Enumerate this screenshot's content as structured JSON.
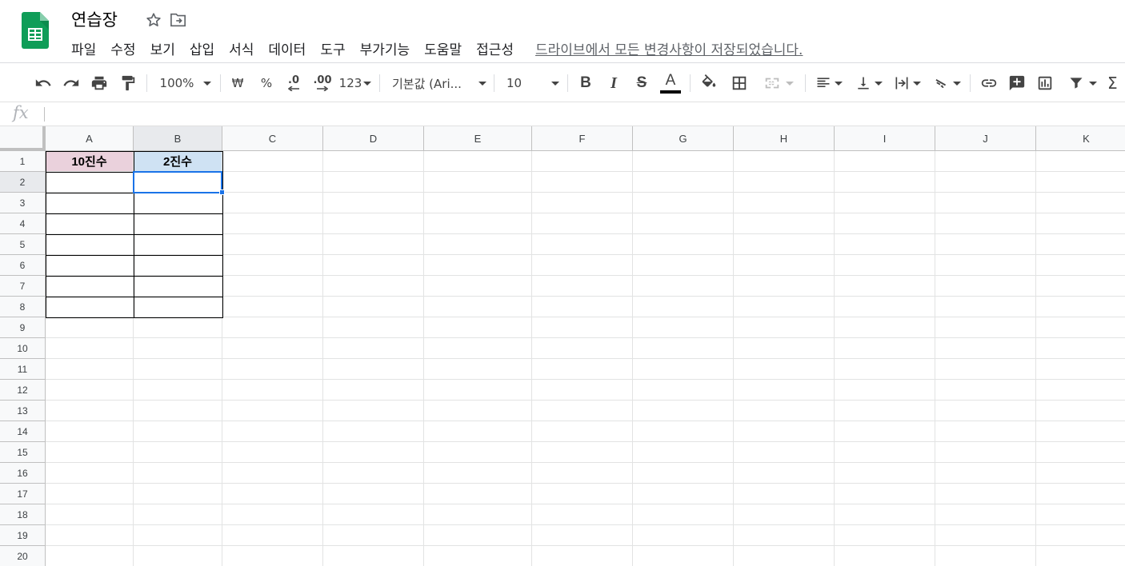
{
  "app": {
    "title": "연습장",
    "menus": [
      "파일",
      "수정",
      "보기",
      "삽입",
      "서식",
      "데이터",
      "도구",
      "부가기능",
      "도움말",
      "접근성"
    ],
    "save_status": "드라이브에서 모든 변경사항이 저장되었습니다."
  },
  "toolbar": {
    "zoom": "100%",
    "currency": "₩",
    "percent": "%",
    "decimal_decrease": ".0",
    "decimal_increase": ".00",
    "number_format": "123",
    "font_name": "기본값 (Ari...",
    "font_size": "10",
    "bold": "B",
    "italic": "I",
    "strikethrough": "S",
    "text_color_letter": "A",
    "text_color": "#000000",
    "sigma": "Σ"
  },
  "formula_bar": {
    "fx_label": "fx",
    "value": ""
  },
  "sheet": {
    "columns": [
      "A",
      "B",
      "C",
      "D",
      "E",
      "F",
      "G",
      "H",
      "I",
      "J",
      "K"
    ],
    "rows": [
      "1",
      "2",
      "3",
      "4",
      "5",
      "6",
      "7",
      "8",
      "9",
      "10",
      "11",
      "12",
      "13",
      "14",
      "15",
      "16",
      "17",
      "18",
      "19",
      "20"
    ],
    "cells": {
      "A1": {
        "value": "10진수",
        "background": "#ead1dc"
      },
      "B1": {
        "value": "2진수",
        "background": "#cfe2f3"
      }
    },
    "selected_cell": "B2",
    "accent": "#1a73e8"
  }
}
